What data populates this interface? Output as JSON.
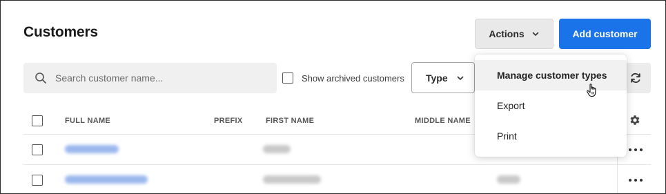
{
  "page": {
    "title": "Customers"
  },
  "toolbar": {
    "actions_label": "Actions",
    "add_label": "Add customer"
  },
  "search": {
    "placeholder": "Search customer name...",
    "value": ""
  },
  "filters": {
    "archived_label": "Show archived customers",
    "archived_checked": false,
    "type_label": "Type"
  },
  "table": {
    "columns": [
      "FULL NAME",
      "PREFIX",
      "FIRST NAME",
      "MIDDLE NAME"
    ]
  },
  "actions_menu": {
    "items": [
      "Manage customer types",
      "Export",
      "Print"
    ],
    "hovered": "Manage customer types"
  },
  "icons": {
    "search": "search-icon",
    "chevron": "chevron-down-icon",
    "refresh": "refresh-icon",
    "settings": "gear-icon",
    "more": "more-horizontal-icon",
    "cursor": "hand-pointer-icon"
  },
  "colors": {
    "primary": "#1a73e8",
    "secondary_button": "#e9e9ea",
    "search_bg": "#f0f0f1"
  }
}
